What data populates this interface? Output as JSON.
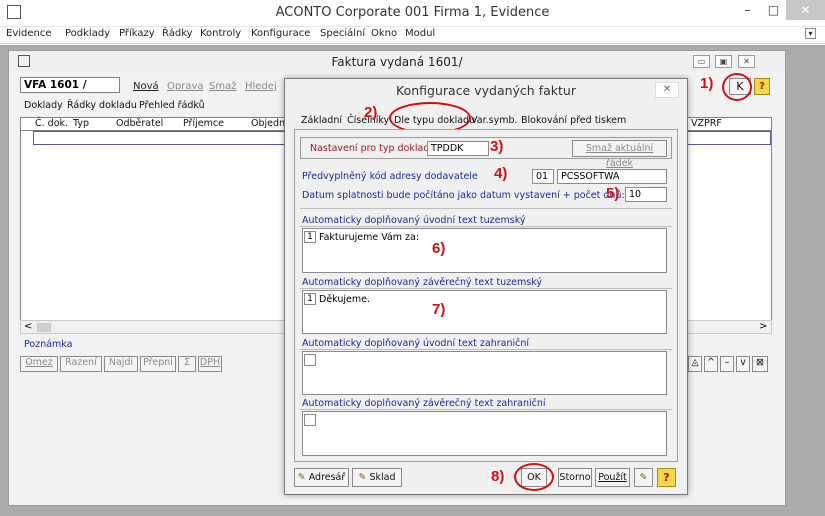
{
  "app": {
    "title": "ACONTO Corporate 001 Firma 1, Evidence",
    "minimize": "–",
    "maximize": "□",
    "close": "✕"
  },
  "menu": [
    "Evidence",
    "Podklady",
    "Příkazy",
    "Řádky",
    "Kontroly",
    "Konfigurace",
    "Speciální",
    "Okno",
    "Modul"
  ],
  "menu_end_icon": "▾",
  "inner": {
    "title": "Faktura vydaná 1601/",
    "doc_number": "VFA 1601 /",
    "toolbar": [
      "Nová",
      "Oprava",
      "Smaž",
      "Hledej"
    ],
    "tabs": [
      "Doklady",
      "Řádky dokladu",
      "Přehled řádků"
    ],
    "columns": [
      "Č. dok.",
      "Typ",
      "Odběratel",
      "Příjemce",
      "Objedn"
    ],
    "right_col": "VZPRF",
    "k_button": "K",
    "help": "?",
    "scroll_left": "<",
    "scroll_right": ">",
    "note_label": "Poznámka",
    "bottom_buttons": [
      "Omez",
      "Řazení",
      "Najdi",
      "Přepni",
      "Σ",
      "DPH"
    ],
    "nav_buttons": [
      "◬",
      "^",
      "–",
      "v",
      "⊠"
    ]
  },
  "dialog": {
    "title": "Konfigurace vydaných faktur",
    "close": "✕",
    "tabs": [
      "Základní",
      "Číselníky",
      "Dle typu dokladu",
      "Var.symb.",
      "Blokování před tiskem"
    ],
    "type_label": "Nastavení pro typ dokladu",
    "type_value": "TPDDK",
    "delete_row": "Smaž aktuální řádek",
    "supplier_label": "Předvyplněný kód adresy dodavatele",
    "supplier_code": "01",
    "supplier_name": "PCSSOFTWA",
    "due_label": "Datum splatnosti bude počítáno jako datum vystavení + počet dnů:",
    "due_value": "10",
    "memos": [
      {
        "label": "Automaticky doplňovaný úvodní text tuzemský",
        "line": "1",
        "text": "Fakturujeme Vám za:"
      },
      {
        "label": "Automaticky doplňovaný závěrečný text tuzemský",
        "line": "1",
        "text": "Děkujeme."
      },
      {
        "label": "Automaticky doplňovaný úvodní text zahraniční",
        "line": "",
        "text": ""
      },
      {
        "label": "Automaticky doplňovaný závěrečný text zahraniční",
        "line": "",
        "text": ""
      }
    ],
    "buttons": {
      "adresar": "Adresář",
      "sklad": "Sklad",
      "ok": "OK",
      "storno": "Storno",
      "pouzit": "Použít",
      "help": "?"
    }
  },
  "annotations": [
    "1)",
    "2)",
    "3)",
    "4)",
    "5)",
    "6)",
    "7)",
    "8)"
  ],
  "colors": {
    "annotation": "#d01010",
    "dialog_label": "#1a2a9a",
    "mdi_background": "#ababab"
  }
}
